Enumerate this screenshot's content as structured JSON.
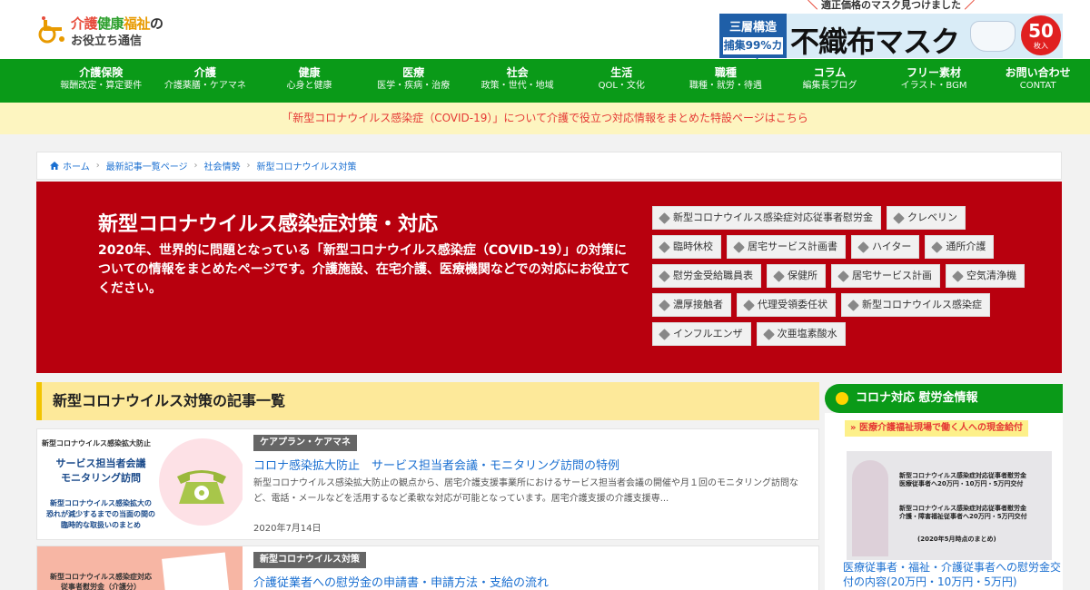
{
  "header": {
    "logo": {
      "part1": "介護",
      "part2": "健康",
      "part3": "福祉",
      "part4": "の",
      "line2": "お役立ち通信"
    },
    "ad": {
      "top_text": "適正価格のマスク見つけました",
      "tag_line1": "三層構造",
      "tag_line2": "捕集99%カット",
      "title": "不織布マスク",
      "badge_num": "50",
      "badge_unit": "枚入"
    }
  },
  "nav": [
    {
      "main": "介護保険",
      "sub": "報酬改定・算定要件"
    },
    {
      "main": "介護",
      "sub": "介護薬膳・ケアマネ"
    },
    {
      "main": "健康",
      "sub": "心身と健康"
    },
    {
      "main": "医療",
      "sub": "医学・疾病・治療"
    },
    {
      "main": "社会",
      "sub": "政策・世代・地域"
    },
    {
      "main": "生活",
      "sub": "QOL・文化"
    },
    {
      "main": "職種",
      "sub": "職種・就労・待遇"
    },
    {
      "main": "コラム",
      "sub": "編集長ブログ"
    },
    {
      "main": "フリー素材",
      "sub": "イラスト・BGM"
    },
    {
      "main": "お問い合わせ",
      "sub": "CONTAT"
    }
  ],
  "notice": "「新型コロナウイルス感染症（COVID-19）」について介護で役立つ対応情報をまとめた特設ページはこちら",
  "breadcrumb": [
    "ホーム",
    "最新記事一覧ページ",
    "社会情勢",
    "新型コロナウイルス対策"
  ],
  "hero": {
    "title": "新型コロナウイルス感染症対策・対応",
    "description": "2020年、世界的に問題となっている「新型コロナウイルス感染症（COVID-19）」の対策についての情報をまとめたページです。介護施設、在宅介護、医療機関などでの対応にお役立てください。",
    "tags": [
      "新型コロナウイルス感染症対応従事者慰労金",
      "クレベリン",
      "臨時休校",
      "居宅サービス計画書",
      "ハイター",
      "通所介護",
      "慰労金受給職員表",
      "保健所",
      "居宅サービス計画",
      "空気清浄機",
      "濃厚接触者",
      "代理受領委任状",
      "新型コロナウイルス感染症",
      "インフルエンザ",
      "次亜塩素酸水"
    ]
  },
  "section_title": "新型コロナウイルス対策の記事一覧",
  "articles": [
    {
      "category": "ケアプラン・ケアマネ",
      "title": "コロナ感染拡大防止　サービス担当者会議・モニタリング訪問の特例",
      "excerpt": "新型コロナウイルス感染拡大防止の観点から、居宅介護支援事業所におけるサービス担当者会議の開催や月１回のモニタリング訪問など、電話・メールなどを活用するなど柔軟な対応が可能となっています。居宅介護支援の介護支援専...",
      "date": "2020年7月14日",
      "thumb_line1": "新型コロナウイルス感染拡大防止",
      "thumb_line2a": "サービス担当者会議",
      "thumb_line2b": "モニタリング訪問",
      "thumb_line3a": "新型コロナウイルス感染拡大の",
      "thumb_line3b": "恐れが減少するまでの当面の間の",
      "thumb_line3c": "臨時的な取扱いのまとめ"
    },
    {
      "category": "新型コロナウイルス対策",
      "title": "介護従業者への慰労金の申請書・申請方法・支給の流れ",
      "thumb_line1": "新型コロナウイルス感染症対応",
      "thumb_line2": "従事者慰労金（介護分）"
    }
  ],
  "sidebar": {
    "heading": "コロナ対応 慰労金情報",
    "sub_label": "医療介護福祉現場で働く人への現金給付",
    "img_lines": [
      "新型コロナウイルス感染症対応従事者慰労金",
      "医療従事者へ20万円・10万円・5万円交付",
      "新型コロナウイルス感染症対応従事者慰労金",
      "介護・障害福祉従事者へ20万円・5万円交付",
      "(2020年5月時点のまとめ)"
    ],
    "link": "医療従事者・福祉・介護従事者への慰労金交付の内容(20万円・10万円・5万円)"
  }
}
